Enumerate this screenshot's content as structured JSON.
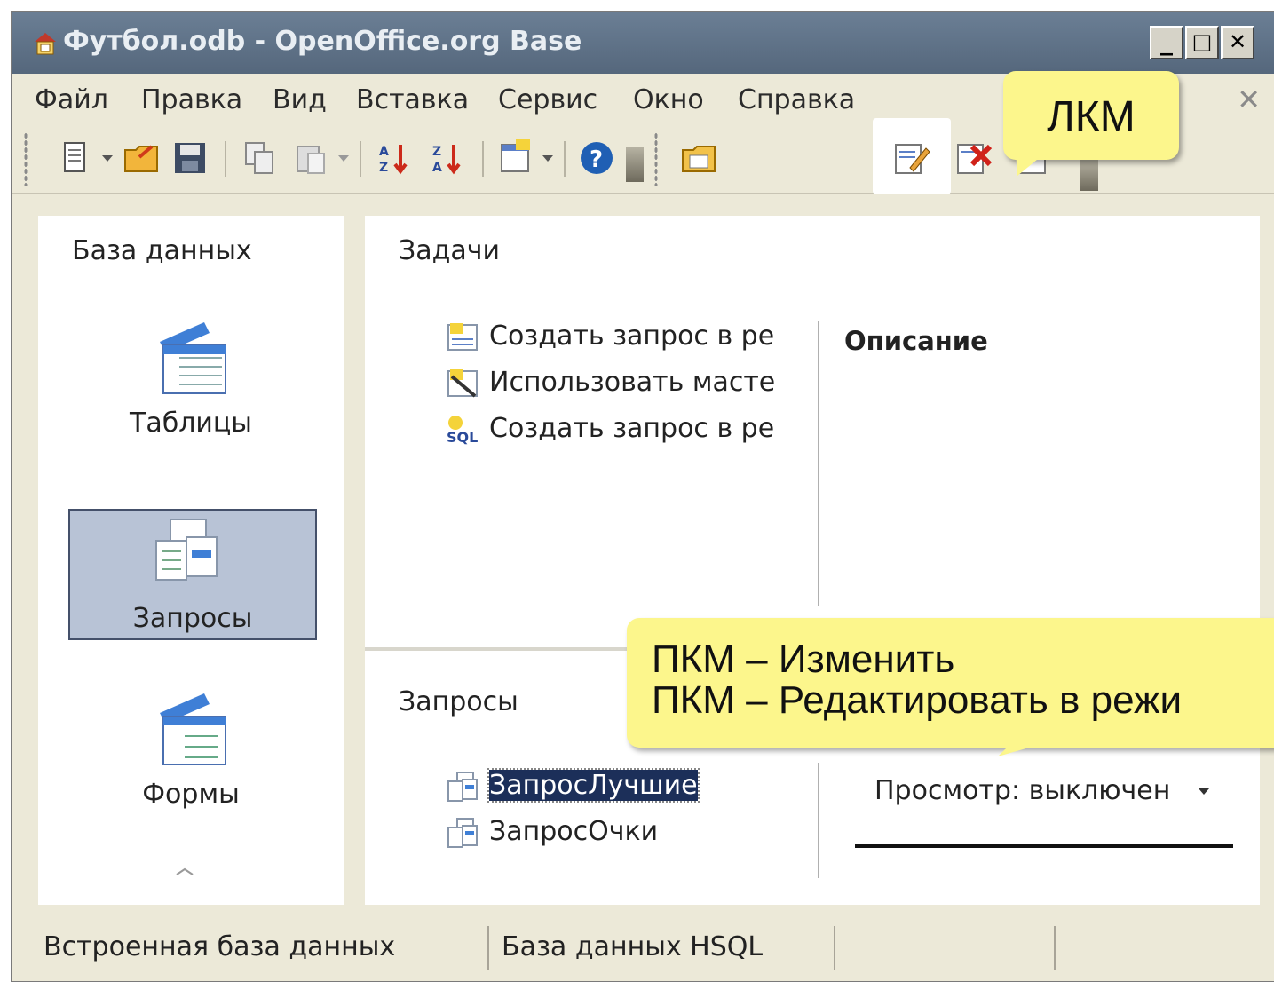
{
  "window": {
    "title": "Футбол.odb - OpenOffice.org Base",
    "minimize": "_",
    "maximize": "□",
    "close": "✕"
  },
  "menu": {
    "items": [
      "Файл",
      "Правка",
      "Вид",
      "Вставка",
      "Сервис",
      "Окно",
      "Справка"
    ],
    "close_doc": "✕"
  },
  "toolbar": {
    "icons": [
      "new-icon",
      "open-icon",
      "save-icon",
      "copy-icon",
      "paste-icon",
      "sort-ascending-icon",
      "sort-descending-icon",
      "form-icon",
      "help-icon",
      "open-object-icon",
      "edit-icon",
      "delete-icon",
      "rename-icon"
    ]
  },
  "left_panel": {
    "title": "База данных",
    "categories": [
      {
        "label": "Таблицы",
        "icon": "tables-icon",
        "selected": false
      },
      {
        "label": "Запросы",
        "icon": "queries-icon",
        "selected": true
      },
      {
        "label": "Формы",
        "icon": "forms-icon",
        "selected": false
      }
    ]
  },
  "tasks": {
    "title": "Задачи",
    "items": [
      {
        "label": "Создать запрос в ре",
        "icon": "design-query-icon"
      },
      {
        "label": "Использовать масте",
        "icon": "wizard-icon"
      },
      {
        "label": "Создать запрос в ре",
        "icon": "sql-icon"
      }
    ],
    "description_title": "Описание"
  },
  "queries": {
    "title": "Запросы",
    "items": [
      {
        "label": "ЗапросЛучшие",
        "selected": true
      },
      {
        "label": "ЗапросОчки",
        "selected": false
      }
    ],
    "preview_label": "Просмотр: выключен"
  },
  "status": {
    "cells": [
      "Встроенная база данных",
      "База данных HSQL",
      ""
    ]
  },
  "callouts": {
    "lkm": "ЛКМ",
    "pkm_line1": "ПКМ – Изменить",
    "pkm_line2": "ПКМ – Редактировать в режи"
  },
  "colors": {
    "titlebar": "#5d7086",
    "selection": "#1c2f59",
    "callout": "#fcf68c",
    "category_selected": "#b8c3d6"
  }
}
